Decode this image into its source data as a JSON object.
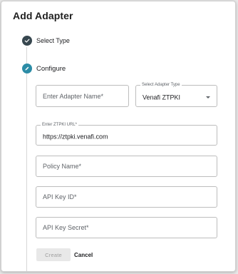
{
  "dialog": {
    "title": "Add Adapter"
  },
  "steps": [
    {
      "label": "Select Type",
      "state": "completed",
      "icon": "check-icon"
    },
    {
      "label": "Configure",
      "state": "active",
      "icon": "pencil-icon"
    }
  ],
  "form": {
    "adapter_name": {
      "placeholder": "Enter Adapter Name*",
      "value": ""
    },
    "adapter_type": {
      "label": "Select Adapter Type",
      "value": "Venafi ZTPKI"
    },
    "ztpki_url": {
      "label": "Enter ZTPKI URL*",
      "value": "https://ztpki.venafi.com"
    },
    "policy_name": {
      "placeholder": "Policy Name*",
      "value": ""
    },
    "api_key_id": {
      "placeholder": "API Key ID*",
      "value": ""
    },
    "api_key_secret": {
      "placeholder": "API Key Secret*",
      "value": ""
    }
  },
  "actions": {
    "create_label": "Create",
    "cancel_label": "Cancel"
  },
  "colors": {
    "completed_step": "#37474f",
    "active_step": "#2b8ca6",
    "disabled_button": "#e8e8e8"
  }
}
